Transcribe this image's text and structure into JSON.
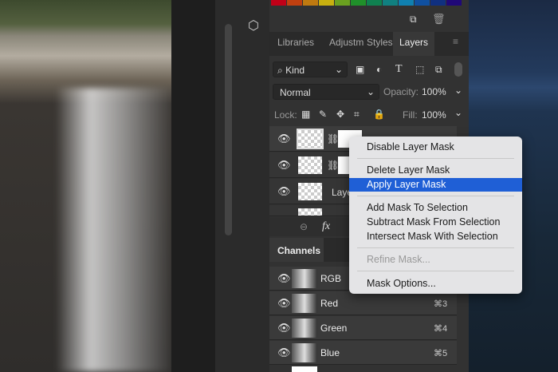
{
  "swatches": [
    "#c00018",
    "#c04010",
    "#c07a10",
    "#c8b010",
    "#6aa020",
    "#20902a",
    "#108050",
    "#108080",
    "#1080b0",
    "#1050a0",
    "#103080",
    "#200878"
  ],
  "tabs": [
    "Libraries",
    "Adjustm",
    "Styles",
    "Layers"
  ],
  "filter": {
    "kind": "Kind"
  },
  "blend": {
    "mode": "Normal",
    "opacity_label": "Opacity:",
    "opacity": "100%"
  },
  "lock": {
    "label": "Lock:",
    "fill_label": "Fill:",
    "fill": "100%"
  },
  "layers": [
    {
      "name": ""
    },
    {
      "name": ""
    },
    {
      "name": "Layer"
    },
    {
      "name": ""
    }
  ],
  "channels_title": "Channels",
  "channels": [
    {
      "name": "RGB",
      "shortcut": ""
    },
    {
      "name": "Red",
      "shortcut": "⌘3"
    },
    {
      "name": "Green",
      "shortcut": "⌘4"
    },
    {
      "name": "Blue",
      "shortcut": "⌘5"
    }
  ],
  "menu": {
    "disable": "Disable Layer Mask",
    "delete": "Delete Layer Mask",
    "apply": "Apply Layer Mask",
    "add": "Add Mask To Selection",
    "subtract": "Subtract Mask From Selection",
    "intersect": "Intersect Mask With Selection",
    "refine": "Refine Mask...",
    "options": "Mask Options..."
  },
  "fx": "fx"
}
